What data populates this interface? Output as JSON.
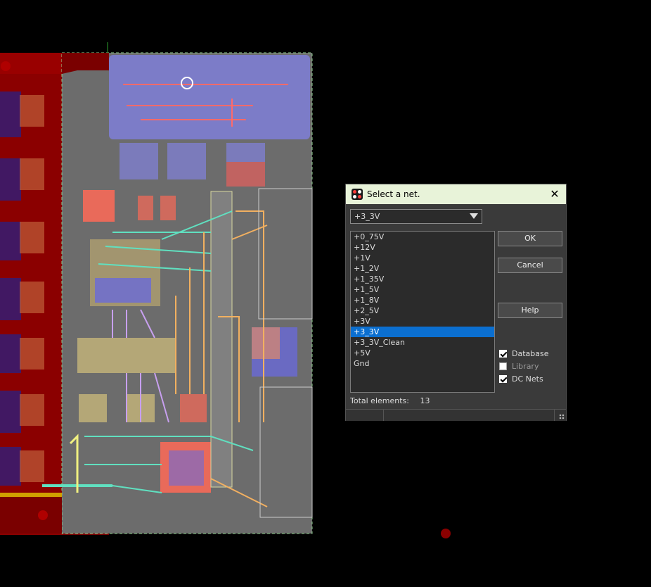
{
  "dialog": {
    "title": "Select a net.",
    "close_glyph": "✕",
    "selected_net": "+3_3V",
    "nets": [
      "+0_75V",
      "+12V",
      "+1V",
      "+1_2V",
      "+1_35V",
      "+1_5V",
      "+1_8V",
      "+2_5V",
      "+3V",
      "+3_3V",
      "+3_3V_Clean",
      "+5V",
      "Gnd"
    ],
    "selected_index": 9,
    "buttons": {
      "ok": "OK",
      "cancel": "Cancel",
      "help": "Help"
    },
    "checkboxes": [
      {
        "label": "Database",
        "checked": true,
        "enabled": true
      },
      {
        "label": "Library",
        "checked": false,
        "enabled": false
      },
      {
        "label": "DC Nets",
        "checked": true,
        "enabled": true
      }
    ],
    "total_label": "Total elements:",
    "total_count": "13"
  },
  "colors": {
    "accent_selection": "#0b6fd0",
    "titlebar": "#e8f3d9",
    "pcb_board": "#6e6e6e",
    "pcb_copper_red": "#8b0000",
    "pcb_blue_region": "#7b7bd0"
  },
  "icons": {
    "app": "pcb-net-icon",
    "dropdown": "chevron-down-icon",
    "close": "close-icon"
  }
}
